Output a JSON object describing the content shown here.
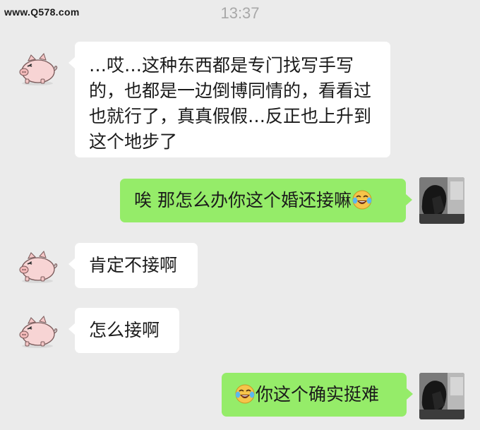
{
  "header": {
    "watermark": "www.Q578.com",
    "time": "13:37"
  },
  "messages": [
    {
      "side": "left",
      "avatar": "pig-avatar",
      "text": "…哎…这种东西都是专门找写手写的，也都是一边倒博同情的，看看过也就行了，真真假假…反正也上升到这个地步了"
    },
    {
      "side": "right",
      "avatar": "self-avatar-photo",
      "text": "唉 那怎么办你这个婚还接嘛",
      "emoji": "laughing-crying-emoji"
    },
    {
      "side": "left",
      "avatar": "pig-avatar",
      "text": "肯定不接啊"
    },
    {
      "side": "left",
      "avatar": "pig-avatar",
      "text": "怎么接啊"
    },
    {
      "side": "right",
      "avatar": "self-avatar-photo",
      "text": "你这个确实挺难",
      "emoji": "laughing-crying-emoji"
    }
  ],
  "colors": {
    "background": "#ebebeb",
    "left_bubble": "#ffffff",
    "right_bubble": "#95ec69",
    "timestamp": "#a8a8a8"
  }
}
